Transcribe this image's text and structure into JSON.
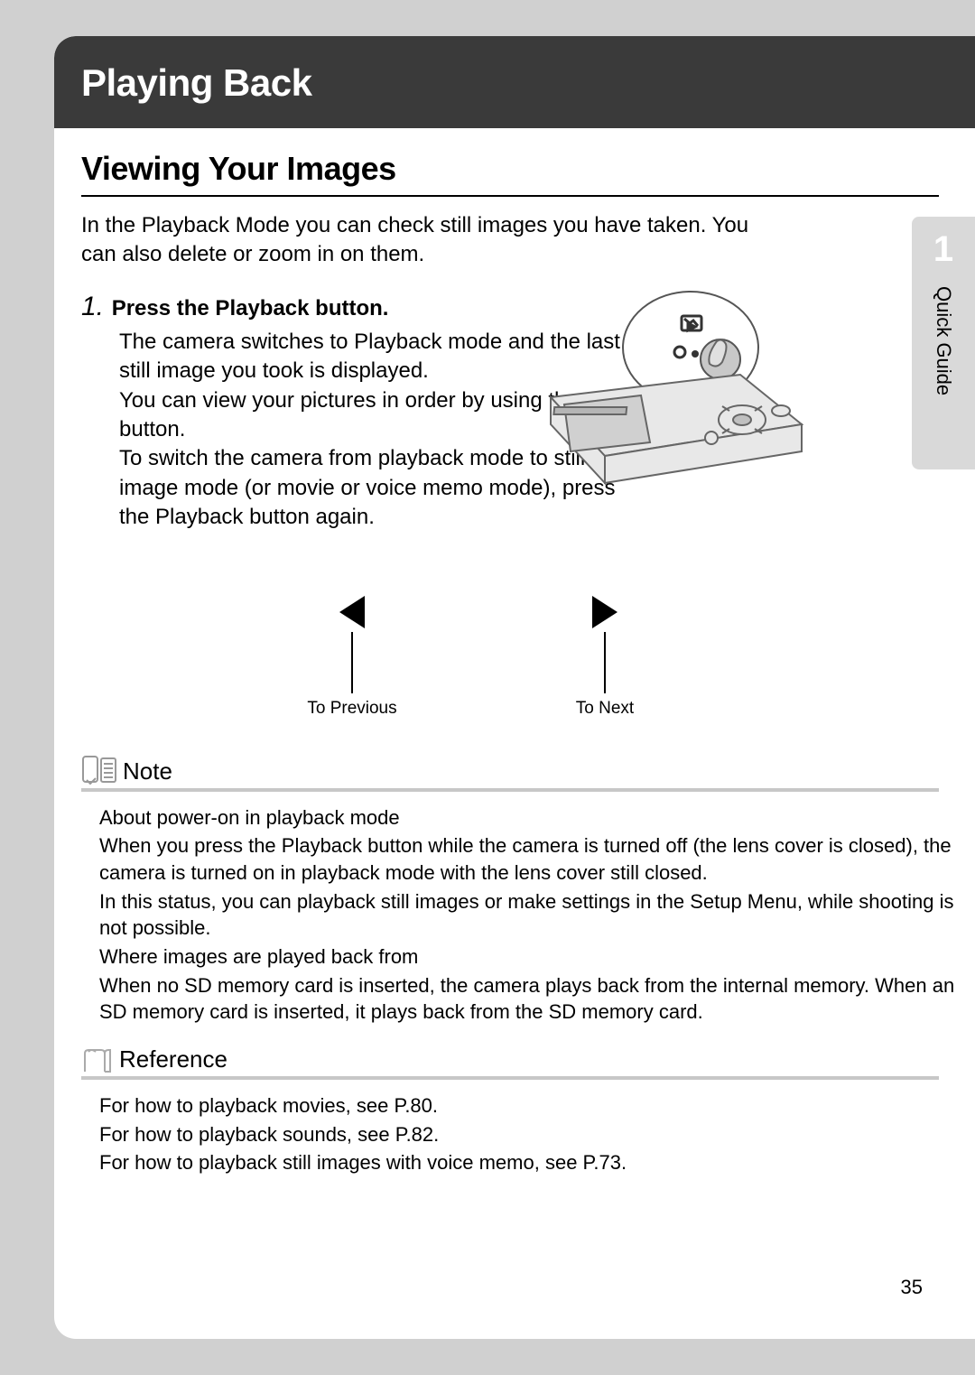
{
  "chapter_title": "Playing Back",
  "section_title": "Viewing Your Images",
  "intro": "In the Playback Mode you can check still images you have taken. You can also delete or zoom in on them.",
  "step": {
    "num": "1.",
    "title": "Press the Playback button.",
    "body_lines": [
      "The camera switches to Playback mode and the last still image you took is displayed.",
      "You can view your pictures in order by using the #$   button.",
      "To switch the camera from playback mode to still image mode (or movie or voice memo mode), press the Playback button again."
    ]
  },
  "nav": {
    "prev": "To Previous",
    "next": "To Next"
  },
  "side_tab": {
    "num": "1",
    "label": "Quick Guide"
  },
  "note": {
    "title": "Note",
    "lines": [
      "About power-on in playback mode",
      "When you press the Playback button while the camera is turned off (the lens cover is closed), the camera is turned on in playback mode with the lens cover still closed.",
      "In this status, you can playback still images or make settings in the Setup Menu, while shooting is not possible.",
      "Where images are played back from",
      "When no SD memory card is inserted, the camera plays back from the internal memory. When an SD memory card is inserted, it plays back from the SD memory card."
    ]
  },
  "reference": {
    "title": "Reference",
    "lines": [
      "For how to playback movies, see P.80.",
      "For how to playback sounds, see P.82.",
      "For how to playback still images with voice memo, see P.73."
    ]
  },
  "page_number": "35"
}
